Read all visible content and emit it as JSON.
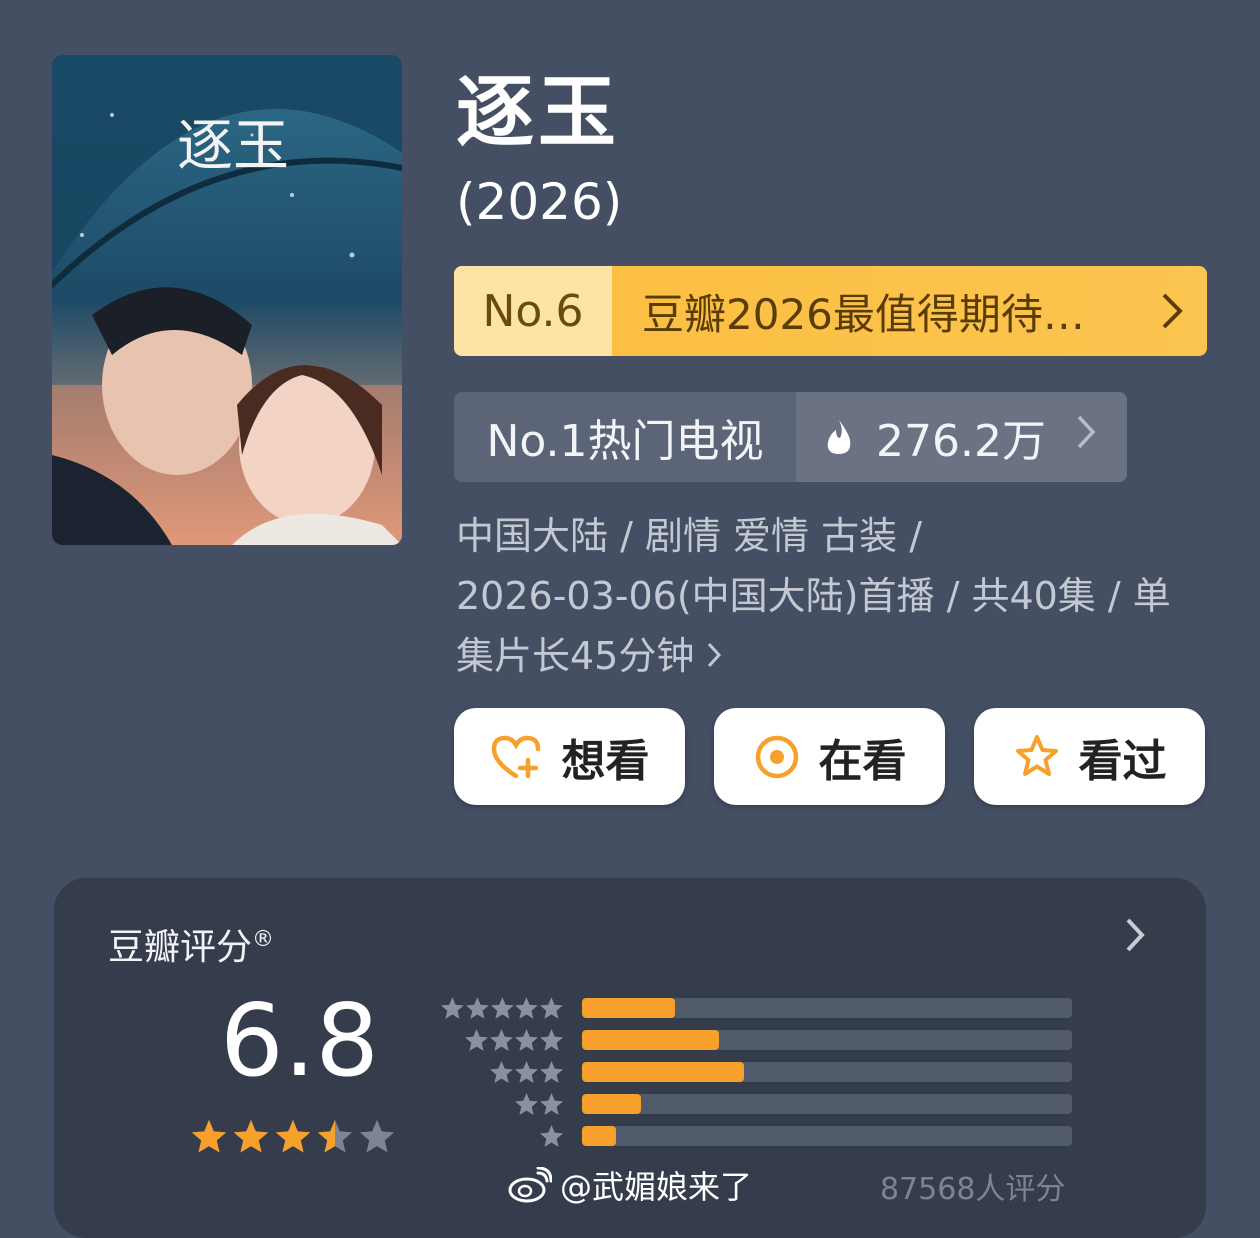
{
  "show": {
    "title": "逐玉",
    "year": "(2026)",
    "poster_title": "逐玉"
  },
  "ranking": {
    "rank": "No.6",
    "list_name": "豆瓣2026最值得期待…",
    "chevron": ">"
  },
  "hot": {
    "label": "No.1热门电视",
    "count": "276.2万",
    "icon": "fire-icon",
    "chevron": ">"
  },
  "meta": {
    "line1": "中国大陆 / 剧情 爱情 古装 /",
    "line2": "2026-03-06(中国大陆)首播 / 共40集 / 单",
    "line3": "集片长45分钟",
    "chevron": ">"
  },
  "actions": {
    "want": "想看",
    "watching": "在看",
    "watched": "看过"
  },
  "rating": {
    "title": "豆瓣评分",
    "registered_mark": "®",
    "score": "6.8",
    "star_value": 3.5,
    "distribution": [
      {
        "stars": 5,
        "fraction": 0.19
      },
      {
        "stars": 4,
        "fraction": 0.28
      },
      {
        "stars": 3,
        "fraction": 0.33
      },
      {
        "stars": 2,
        "fraction": 0.12
      },
      {
        "stars": 1,
        "fraction": 0.07
      }
    ],
    "count_text": "87568人评分",
    "chevron": ">"
  },
  "watermark": {
    "text": "@武媚娘来了",
    "icon": "weibo-icon"
  },
  "colors": {
    "background": "#454f63",
    "accent_orange": "#f7a02c",
    "rank_bar": "#fbbd3f",
    "card": "#353c4b"
  }
}
